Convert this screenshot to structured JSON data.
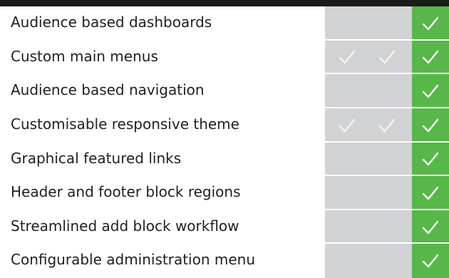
{
  "features": [
    {
      "label": "Audience based dashboards",
      "tiers": [
        false,
        false,
        true
      ]
    },
    {
      "label": "Custom main menus",
      "tiers": [
        true,
        true,
        true
      ]
    },
    {
      "label": "Audience based navigation",
      "tiers": [
        false,
        false,
        true
      ]
    },
    {
      "label": "Customisable responsive theme",
      "tiers": [
        true,
        true,
        true
      ]
    },
    {
      "label": "Graphical featured links",
      "tiers": [
        false,
        false,
        true
      ]
    },
    {
      "label": "Header and footer block regions",
      "tiers": [
        false,
        false,
        true
      ]
    },
    {
      "label": "Streamlined add block workflow",
      "tiers": [
        false,
        false,
        true
      ]
    },
    {
      "label": "Configurable administration menu",
      "tiers": [
        false,
        false,
        true
      ]
    }
  ],
  "colors": {
    "tier_grey": "#d1d2d4",
    "tier_green": "#57b748",
    "check_on_grey": "#ffffff",
    "check_on_green": "#ffffff"
  },
  "icons": {
    "check": "check-icon"
  }
}
